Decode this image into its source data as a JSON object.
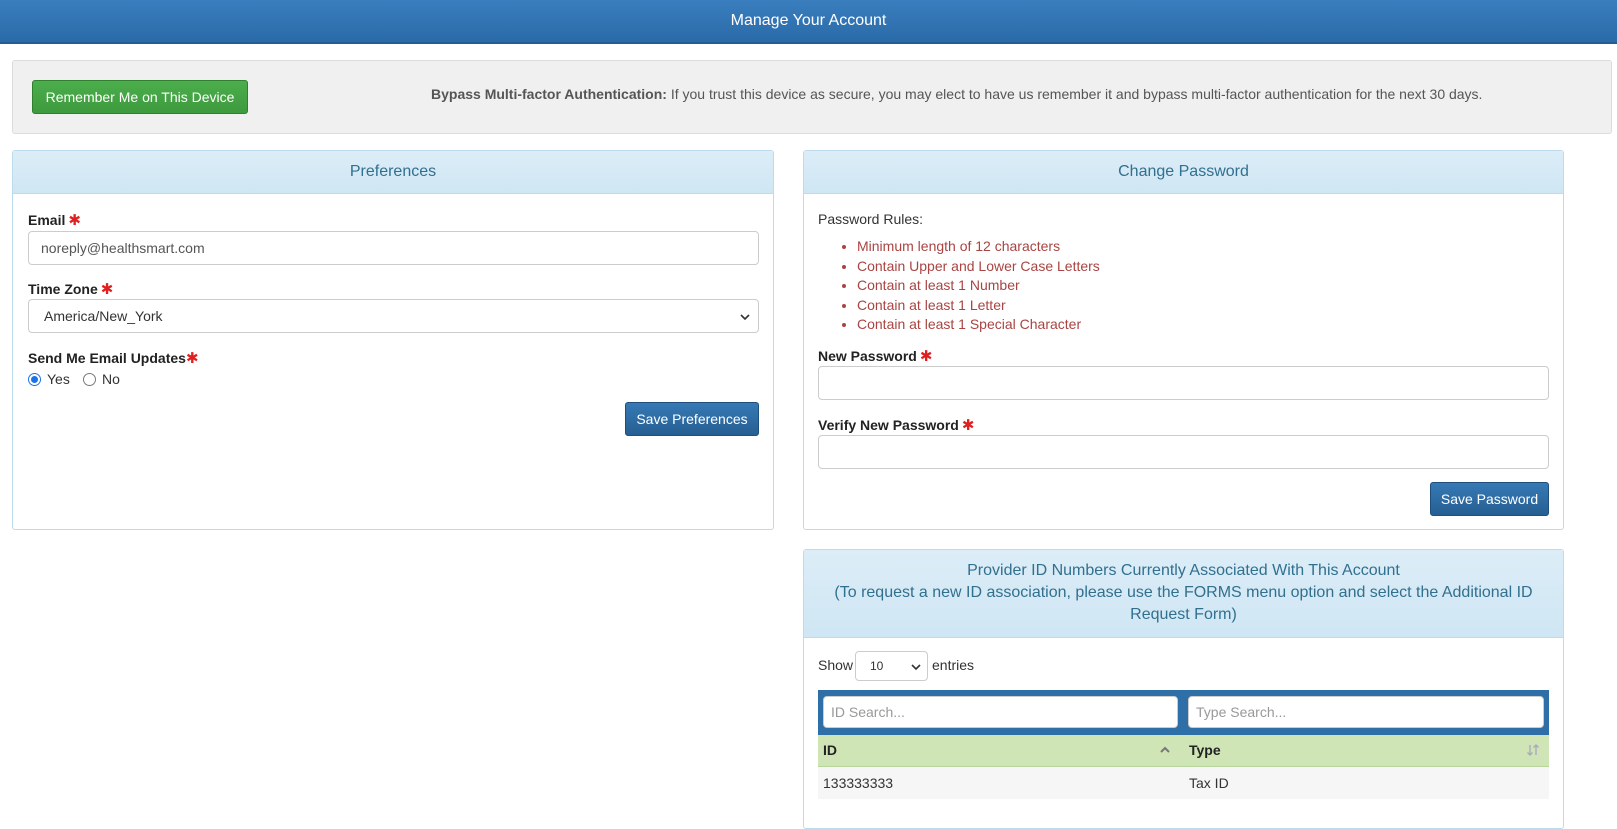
{
  "header": {
    "title": "Manage Your Account"
  },
  "mfa": {
    "button_label": "Remember Me on This Device",
    "bold_label": "Bypass Multi-factor Authentication:",
    "description": " If you trust this device as secure, you may elect to have us remember it and bypass multi-factor authentication for the next 30 days."
  },
  "preferences": {
    "title": "Preferences",
    "email_label": "Email",
    "email_value": "noreply@healthsmart.com",
    "timezone_label": "Time Zone",
    "timezone_value": "America/New_York",
    "updates_label": "Send Me Email Updates",
    "yes_label": "Yes",
    "no_label": "No",
    "selected": "Yes",
    "save_label": "Save Preferences",
    "required_mark": "✱"
  },
  "password": {
    "title": "Change Password",
    "rules_label": "Password Rules:",
    "rules": [
      "Minimum length of 12 characters",
      "Contain Upper and Lower Case Letters",
      "Contain at least 1 Number",
      "Contain at least 1 Letter",
      "Contain at least 1 Special Character"
    ],
    "new_label": "New Password",
    "new_value": "",
    "verify_label": "Verify New Password",
    "verify_value": "",
    "save_label": "Save Password"
  },
  "provider": {
    "title_line1": "Provider ID Numbers Currently Associated With This Account",
    "title_line2": "(To request a new ID association, please use the FORMS menu option and select the Additional ID Request Form)",
    "show_label": "Show",
    "entries_value": "10",
    "entries_label": "entries",
    "id_search_placeholder": "ID Search...",
    "type_search_placeholder": "Type Search...",
    "columns": [
      "ID",
      "Type"
    ],
    "rows": [
      [
        "133333333",
        "Tax ID"
      ]
    ]
  },
  "colors": {
    "header_blue": "#2f74b5",
    "green_button": "#45a745",
    "blue_button": "#2d6ca5",
    "panel_head": "#d5eaf6",
    "rule_red": "#a94442",
    "table_header_green": "#cfe5b5"
  },
  "icons": {
    "sort_asc": "chevron-up-icon",
    "sort_both": "sort-icon",
    "select_arrow": "chevron-down-icon",
    "required": "asterisk-icon"
  }
}
